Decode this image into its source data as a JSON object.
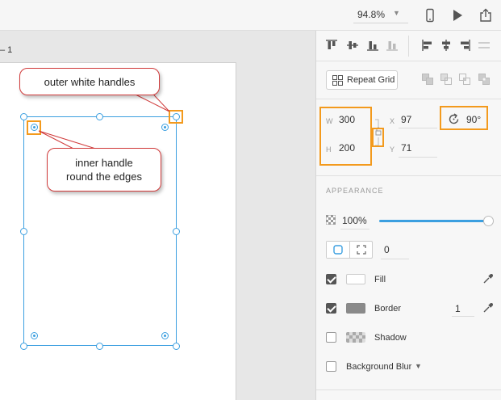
{
  "toolbar": {
    "zoom": "94.8%",
    "icons": [
      "mobile-preview-icon",
      "play-icon",
      "share-icon"
    ]
  },
  "canvas": {
    "artboard_label": "– 1",
    "callouts": {
      "outer": "outer white handles",
      "inner_line1": "inner handle",
      "inner_line2": "round the edges"
    }
  },
  "panel": {
    "repeat_grid": "Repeat Grid",
    "transform": {
      "w_label": "W",
      "w_value": "300",
      "h_label": "H",
      "h_value": "200",
      "x_label": "X",
      "x_value": "97",
      "y_label": "Y",
      "y_value": "71",
      "rotation": "90°"
    },
    "appearance": {
      "title": "APPEARANCE",
      "opacity": "100%",
      "opacity_fraction": 1.0,
      "corner_radius": "0",
      "fill_label": "Fill",
      "fill_checked": true,
      "fill_color": "#ffffff",
      "border_label": "Border",
      "border_checked": true,
      "border_color": "#8a8a8a",
      "border_width": "1",
      "shadow_label": "Shadow",
      "shadow_checked": false,
      "blur_label": "Background Blur",
      "blur_checked": false
    }
  },
  "colors": {
    "selection": "#3b9fe0",
    "highlight": "#f39a1d",
    "callout_border": "#d03a3a"
  }
}
